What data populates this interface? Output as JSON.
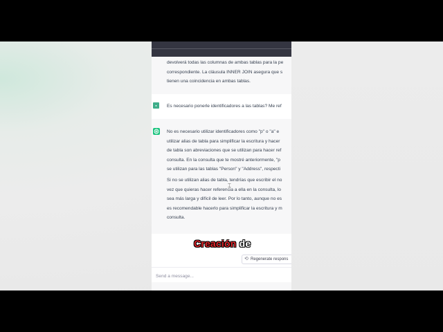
{
  "conversation": {
    "ai_message_1": {
      "lines": [
        "devolverá todas las columnas de ambas tablas para la pe",
        "correspondiente. La cláusula INNER JOIN asegura que s",
        "tienen una coincidencia en ambas tablas."
      ]
    },
    "user_message": {
      "text": "Es necesario ponerle identificadores a las tablas? Me ref"
    },
    "ai_message_2": {
      "paragraph_1": [
        "No es necesario utilizar identificadores como \"p\" o \"a\" e",
        "utilizar alias de tabla para simplificar la escritura y hacer",
        "de tabla son abreviaciones que se utilizan para hacer ref",
        "consulta. En la consulta que te mostré anteriormente, \"p",
        "se utilizan para las tablas \"Person\" y \"Address\", respecti"
      ],
      "paragraph_2": [
        "Si no se utilizan alias de tabla, tendrías que escribir el no",
        "vez que quieras hacer referencia a ella en la consulta, lo",
        "sea más larga y difícil de leer. Por lo tanto, aunque no es",
        "es recomendable hacerlo para simplificar la escritura y m",
        "consulta."
      ]
    }
  },
  "caption": {
    "part_1": "Creación",
    "part_2": "de"
  },
  "regenerate": {
    "label": "Regenerate respons",
    "icon": "refresh-icon"
  },
  "composer": {
    "placeholder": "Send a message..."
  },
  "colors": {
    "topbar": "#343541",
    "ai_background": "#f7f7f8",
    "assistant_avatar": "#19c37d",
    "user_avatar": "#3fae8a",
    "caption_red": "#e0252a"
  }
}
